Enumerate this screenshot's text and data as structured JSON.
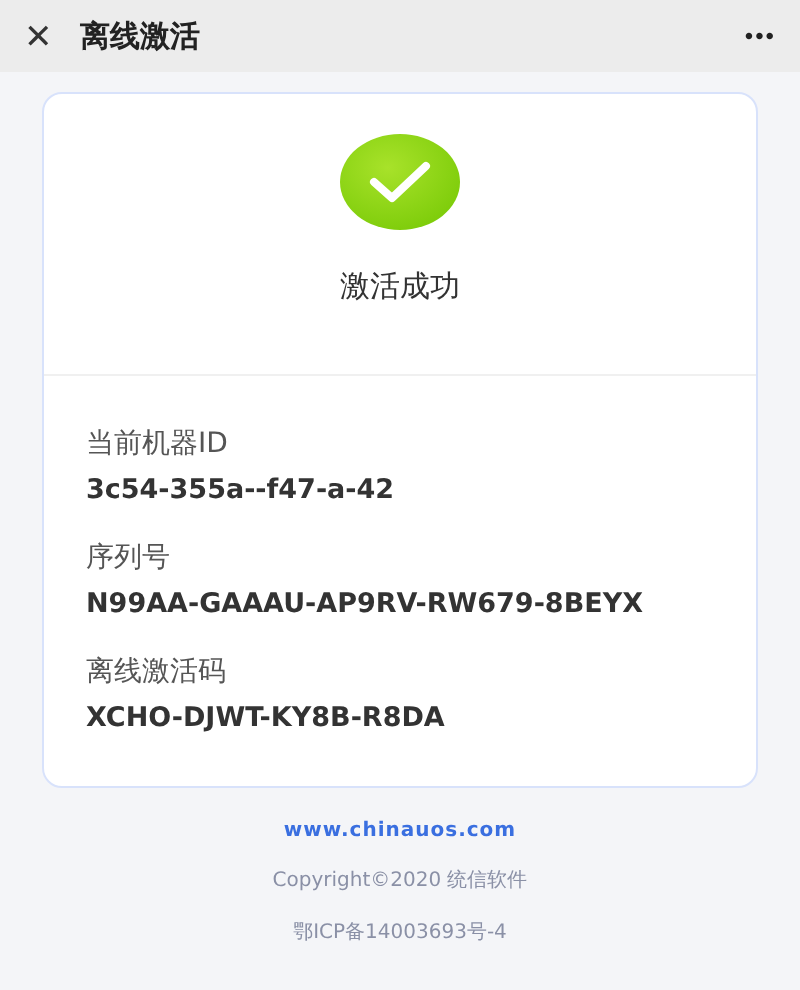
{
  "header": {
    "close": "✕",
    "title": "离线激活",
    "more": "•••"
  },
  "status": {
    "message": "激活成功"
  },
  "fields": [
    {
      "label": "当前机器ID",
      "value": "3c54-355a--f47-a-42"
    },
    {
      "label": "序列号",
      "value": "N99AA-GAAAU-AP9RV-RW679-8BEYX"
    },
    {
      "label": "离线激活码",
      "value": "XCHO-DJWT-KY8B-R8DA"
    }
  ],
  "footer": {
    "link": "www.chinauos.com",
    "copyright": "Copyright©2020 统信软件",
    "icp": "鄂ICP备14003693号-4"
  }
}
